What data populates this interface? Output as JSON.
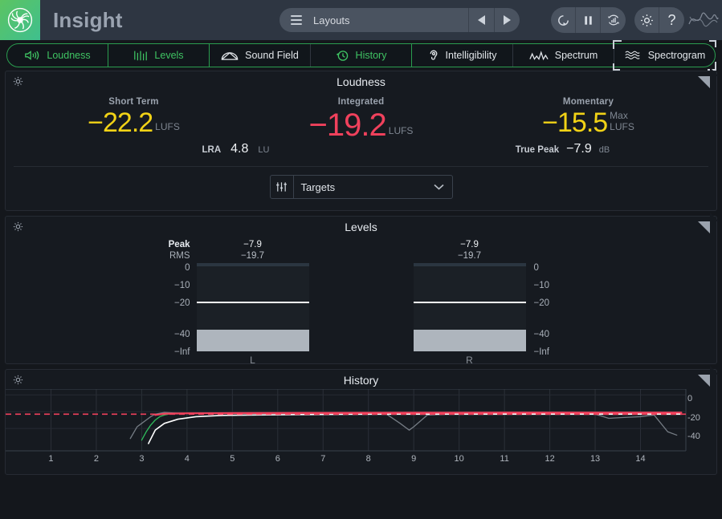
{
  "header": {
    "app_title": "Insight",
    "logo_icon": "izotope-swirl-logo",
    "layouts_label": "Layouts",
    "layouts_icon": "list-icon",
    "prev_icon": "triangle-left-icon",
    "next_icon": "triangle-right-icon",
    "reset_icon": "circular-reset-icon",
    "pause_icon": "pause-icon",
    "meter_reset_icon": "meter-reset-icon",
    "settings_icon": "gear-icon",
    "help_icon": "question-mark-icon",
    "brand_icon": "waveform-brand-icon"
  },
  "tabs": [
    {
      "label": "Loudness",
      "icon": "speaker-waves-icon",
      "active": true,
      "focused": false
    },
    {
      "label": "Levels",
      "icon": "bars-icon",
      "active": true,
      "focused": false
    },
    {
      "label": "Sound Field",
      "icon": "dome-icon",
      "active": false,
      "focused": false
    },
    {
      "label": "History",
      "icon": "clock-arrow-icon",
      "active": true,
      "focused": false
    },
    {
      "label": "Intelligibility",
      "icon": "ear-icon",
      "active": false,
      "focused": false
    },
    {
      "label": "Spectrum",
      "icon": "spectrum-icon",
      "active": false,
      "focused": false
    },
    {
      "label": "Spectrogram",
      "icon": "spectrogram-icon",
      "active": false,
      "focused": true
    }
  ],
  "loudness": {
    "title": "Loudness",
    "gear_icon": "gear-icon",
    "expand_icon": "expand-icon",
    "short_term": {
      "label": "Short Term",
      "value": "−22.2",
      "unit": "LUFS",
      "color": "#f1d216"
    },
    "integrated": {
      "label": "Integrated",
      "value": "−19.2",
      "unit": "LUFS",
      "color": "#f0415c"
    },
    "momentary": {
      "label": "Momentary",
      "value": "−15.5",
      "unit_line1": "Max",
      "unit_line2": "LUFS",
      "color": "#f1d216"
    },
    "lra": {
      "label": "LRA",
      "value": "4.8",
      "unit": "LU"
    },
    "true_peak": {
      "label": "True Peak",
      "value": "−7.9",
      "unit": "dB"
    },
    "targets": {
      "label": "Targets",
      "icon": "sliders-icon",
      "caret": "chevron-down-icon"
    }
  },
  "levels": {
    "title": "Levels",
    "gear_icon": "gear-icon",
    "expand_icon": "expand-icon",
    "peak_label": "Peak",
    "rms_label": "RMS",
    "scale_ticks": [
      "0",
      "−10",
      "−20",
      "−40",
      "−Inf"
    ],
    "channels": [
      {
        "name": "L",
        "peak": "−7.9",
        "rms": "−19.7"
      },
      {
        "name": "R",
        "peak": "−7.9",
        "rms": "−19.7"
      }
    ]
  },
  "history": {
    "title": "History",
    "gear_icon": "gear-icon",
    "expand_icon": "expand-icon",
    "x_ticks": [
      "1",
      "2",
      "3",
      "4",
      "5",
      "6",
      "7",
      "8",
      "9",
      "10",
      "11",
      "12",
      "13",
      "14"
    ],
    "y_ticks": [
      "0",
      "-20",
      "-40"
    ],
    "target_line_color": "#f0415c",
    "integrated_color": "#f0415c",
    "short_term_color": "#2fbd5c",
    "momentary_color": "#8d959e",
    "true_peak_color": "#ffffff"
  },
  "chart_data": {
    "type": "line",
    "title": "History",
    "xlabel": "",
    "ylabel": "",
    "xlim": [
      0,
      15
    ],
    "ylim": [
      -60,
      5
    ],
    "x_ticks": [
      1,
      2,
      3,
      4,
      5,
      6,
      7,
      8,
      9,
      10,
      11,
      12,
      13,
      14
    ],
    "y_ticks": [
      0,
      -20,
      -40
    ],
    "grid": true,
    "annotations": [
      {
        "name": "target-line",
        "type": "hline",
        "value": -23,
        "style": "dashed",
        "color": "#f0415c"
      }
    ],
    "series": [
      {
        "name": "Momentary",
        "color": "#8d959e",
        "x": [
          2.75,
          2.9,
          3.0,
          3.1,
          3.2,
          3.3,
          3.5,
          3.7,
          4.0,
          4.5,
          5.0,
          5.5,
          6.0,
          6.5,
          7.0,
          7.5,
          8.0,
          8.4,
          8.7,
          8.9,
          9.0,
          9.3,
          9.7,
          10.1,
          10.4,
          10.8,
          11.2,
          11.6,
          12.0,
          12.5,
          13.0,
          13.3,
          13.6,
          14.0,
          14.3,
          14.6,
          14.8
        ],
        "values": [
          -52,
          -38,
          -34,
          -30,
          -26,
          -23,
          -21,
          -21.5,
          -22,
          -21.5,
          -22,
          -21.5,
          -22,
          -21.5,
          -22.5,
          -22,
          -22.5,
          -23,
          -34,
          -42,
          -38,
          -24,
          -23,
          -22,
          -21,
          -22,
          -23,
          -22.5,
          -23,
          -22.5,
          -23,
          -28,
          -27,
          -26,
          -24,
          -44,
          -48
        ]
      },
      {
        "name": "Short Term",
        "color": "#2fbd5c",
        "x": [
          3.0,
          3.1,
          3.2,
          3.3,
          3.4,
          3.5,
          3.6
        ],
        "values": [
          -54,
          -44,
          -36,
          -30,
          -26,
          -24,
          -23
        ]
      },
      {
        "name": "True Peak",
        "color": "#ffffff",
        "x": [
          3.15,
          3.3,
          3.5,
          3.8,
          4.2,
          4.8,
          5.5,
          6.5,
          7.5,
          8.5,
          9.5,
          10.5,
          11.5,
          12.5,
          13.5,
          14.5,
          14.9
        ],
        "values": [
          -58,
          -42,
          -34,
          -29,
          -26,
          -24.5,
          -24,
          -23.5,
          -23.2,
          -23,
          -23,
          -23,
          -23,
          -23,
          -23,
          -23,
          -23
        ]
      },
      {
        "name": "Integrated",
        "color": "#f0415c",
        "x": [
          3.3,
          3.5,
          4.0,
          5.0,
          6.0,
          7.0,
          8.0,
          9.0,
          10.0,
          11.0,
          12.0,
          13.0,
          14.0,
          14.9
        ],
        "values": [
          -24,
          -22.5,
          -22,
          -21.8,
          -21.6,
          -21.5,
          -21.4,
          -21.3,
          -21.3,
          -21.2,
          -21.2,
          -21.2,
          -21.2,
          -21.2
        ]
      }
    ]
  }
}
